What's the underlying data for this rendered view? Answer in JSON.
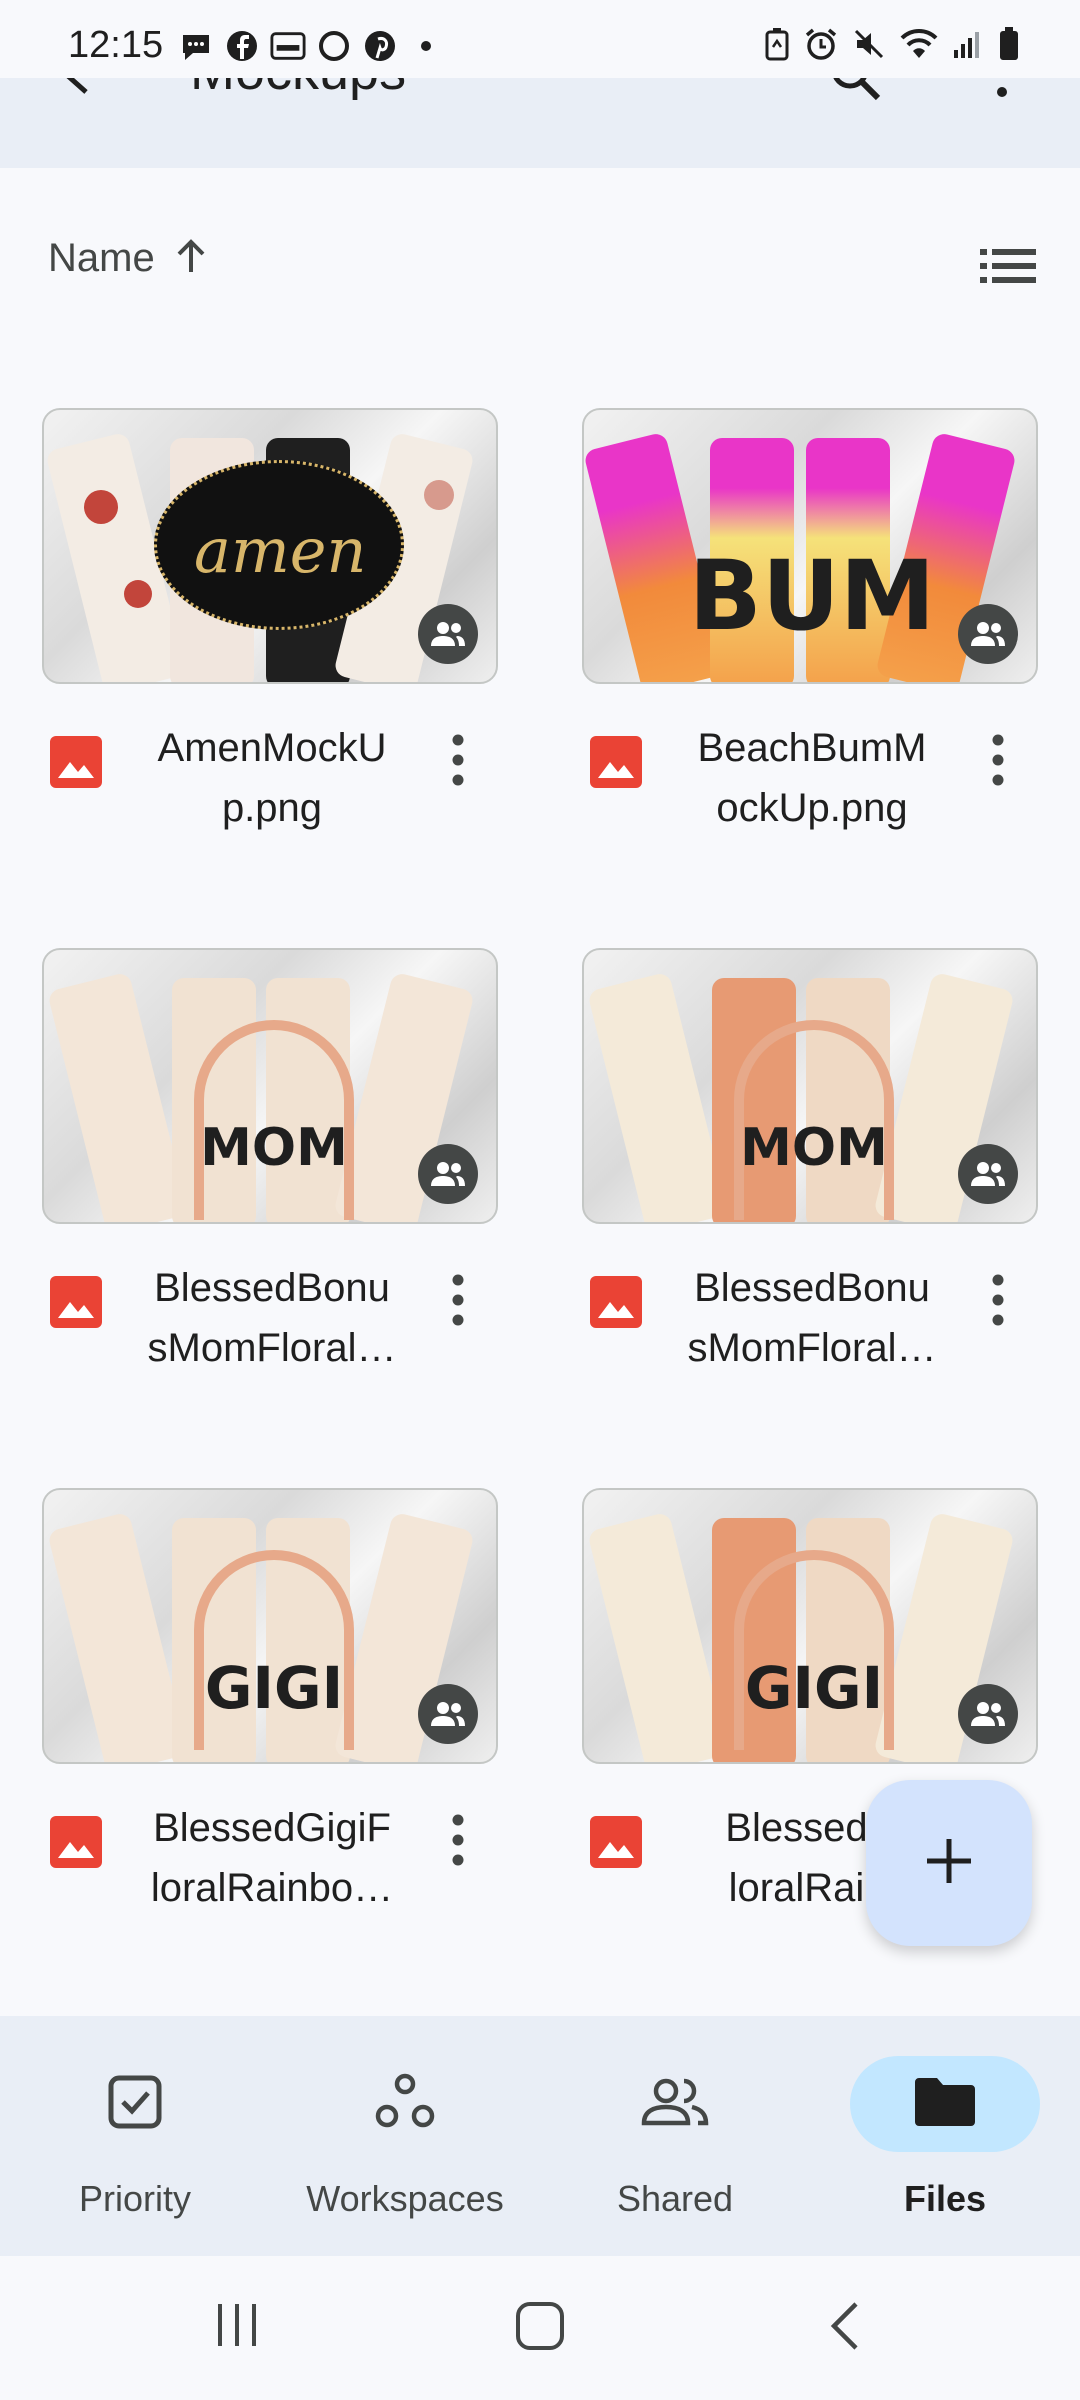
{
  "status": {
    "time": "12:15",
    "notif_icons": [
      "message-icon",
      "facebook-icon",
      "temu-icon",
      "threads-icon",
      "pinterest-icon",
      "dot-icon"
    ],
    "right_icons": [
      "battery-saver-icon",
      "alarm-icon",
      "mute-icon",
      "wifi-icon",
      "signal-icon",
      "battery-icon"
    ]
  },
  "appbar": {
    "title": "Mockups"
  },
  "sort": {
    "label": "Name"
  },
  "files": [
    {
      "line1": "AmenMockU",
      "line2": "p.png",
      "thumb_text": "amen"
    },
    {
      "line1": "BeachBumM",
      "line2": "ockUp.png",
      "thumb_text": "BUM"
    },
    {
      "line1": "BlessedBonu",
      "line2": "sMomFloral…",
      "thumb_text": "MOM"
    },
    {
      "line1": "BlessedBonu",
      "line2": "sMomFloral…",
      "thumb_text": "MOM"
    },
    {
      "line1": "BlessedGigiF",
      "line2": "loralRainbo…",
      "thumb_text": "GIGI"
    },
    {
      "line1": "BlessedG",
      "line2": "loralRainl",
      "thumb_text": "GIGI"
    }
  ],
  "nav": {
    "priority": "Priority",
    "workspaces": "Workspaces",
    "shared": "Shared",
    "files": "Files"
  },
  "colors": {
    "file_icon_red": "#ea4335",
    "nav_active": "#c2e7ff",
    "fab": "#d3e3fd",
    "app_bar": "#e9eef6"
  }
}
